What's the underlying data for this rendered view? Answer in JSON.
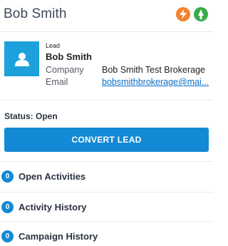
{
  "header": {
    "title": "Bob Smith",
    "icons": [
      "flash-icon",
      "action-icon"
    ],
    "colors": {
      "flash": "#f4822a",
      "action": "#36ad4a"
    }
  },
  "lead": {
    "kind": "Lead",
    "name": "Bob Smith",
    "company_label": "Company",
    "company_value": "Bob Smith Test Brokerage",
    "email_label": "Email",
    "email_value": "bobsmithbrokerage@mai..."
  },
  "status": {
    "text": "Status: Open"
  },
  "convert": {
    "label": "CONVERT LEAD",
    "color": "#1489d5"
  },
  "related": [
    {
      "count": "0",
      "label": "Open Activities"
    },
    {
      "count": "0",
      "label": "Activity History"
    },
    {
      "count": "0",
      "label": "Campaign History"
    }
  ]
}
